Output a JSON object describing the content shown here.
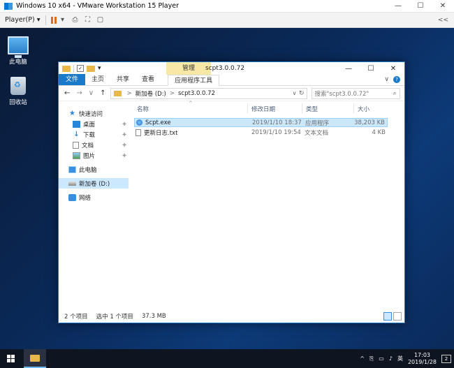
{
  "vmware": {
    "title": "Windows 10 x64 - VMware Workstation 15 Player",
    "minimize": "—",
    "maximize": "☐",
    "close": "✕",
    "player_menu": "Player(P)",
    "player_arrow": "▾",
    "pause_arrow": "▾",
    "toolbar_icons": [
      "send-ctrl-alt-del-icon",
      "fit-window-icon",
      "unity-icon"
    ],
    "collapse_label": "<<"
  },
  "desktop": {
    "icons": [
      {
        "label": "此电脑",
        "icon": "this-pc-icon"
      },
      {
        "label": "回收站",
        "icon": "recycle-bin-icon"
      }
    ]
  },
  "explorer": {
    "title": "scpt3.0.0.72",
    "manage_label": "管理",
    "quick_access_checkbox": "✓",
    "quick_access_arrow": "▾",
    "minimize": "—",
    "maximize": "☐",
    "close": "✕",
    "tabs": {
      "file": "文件",
      "home": "主页",
      "share": "共享",
      "view": "查看",
      "app_tools": "应用程序工具"
    },
    "ribbon_expand": "∨",
    "help": "?",
    "nav_buttons": {
      "back": "←",
      "forward": "→",
      "recent": "∨",
      "up": "↑"
    },
    "path": [
      "新加卷 (D:)",
      "scpt3.0.0.72"
    ],
    "path_sep": ">",
    "path_dropdown": "∨",
    "refresh": "↻",
    "search_placeholder": "搜索\"scpt3.0.0.72\"",
    "search_icon": "⌕",
    "nav_pane": [
      {
        "label": "快速访问",
        "icon": "star-icon",
        "pinned": false
      },
      {
        "label": "桌面",
        "icon": "desktop-folder-icon",
        "pinned": true
      },
      {
        "label": "下载",
        "icon": "download-icon",
        "pinned": true
      },
      {
        "label": "文档",
        "icon": "documents-icon",
        "pinned": true
      },
      {
        "label": "图片",
        "icon": "pictures-icon",
        "pinned": true
      },
      {
        "label": "此电脑",
        "icon": "this-pc-icon",
        "pinned": false
      },
      {
        "label": "新加卷 (D:)",
        "icon": "drive-icon",
        "pinned": false,
        "selected": true
      },
      {
        "label": "网络",
        "icon": "network-icon",
        "pinned": false
      }
    ],
    "pin_glyph": "✚",
    "columns": {
      "name": "名称",
      "date": "修改日期",
      "type": "类型",
      "size": "大小"
    },
    "sort_glyph": "^",
    "files": [
      {
        "name": "Scpt.exe",
        "date": "2019/1/10 18:37",
        "type": "应用程序",
        "size": "38,203 KB",
        "selected": true,
        "icon": "exe-icon"
      },
      {
        "name": "更新日志.txt",
        "date": "2019/1/10 19:54",
        "type": "文本文档",
        "size": "4 KB",
        "selected": false,
        "icon": "text-file-icon"
      }
    ],
    "status": {
      "items": "2 个项目",
      "selected": "选中 1 个项目",
      "size": "37.3 MB"
    }
  },
  "taskbar": {
    "tray_caret": "^",
    "ime": "英",
    "time": "17:03",
    "date": "2019/1/28",
    "notifications": "2"
  }
}
